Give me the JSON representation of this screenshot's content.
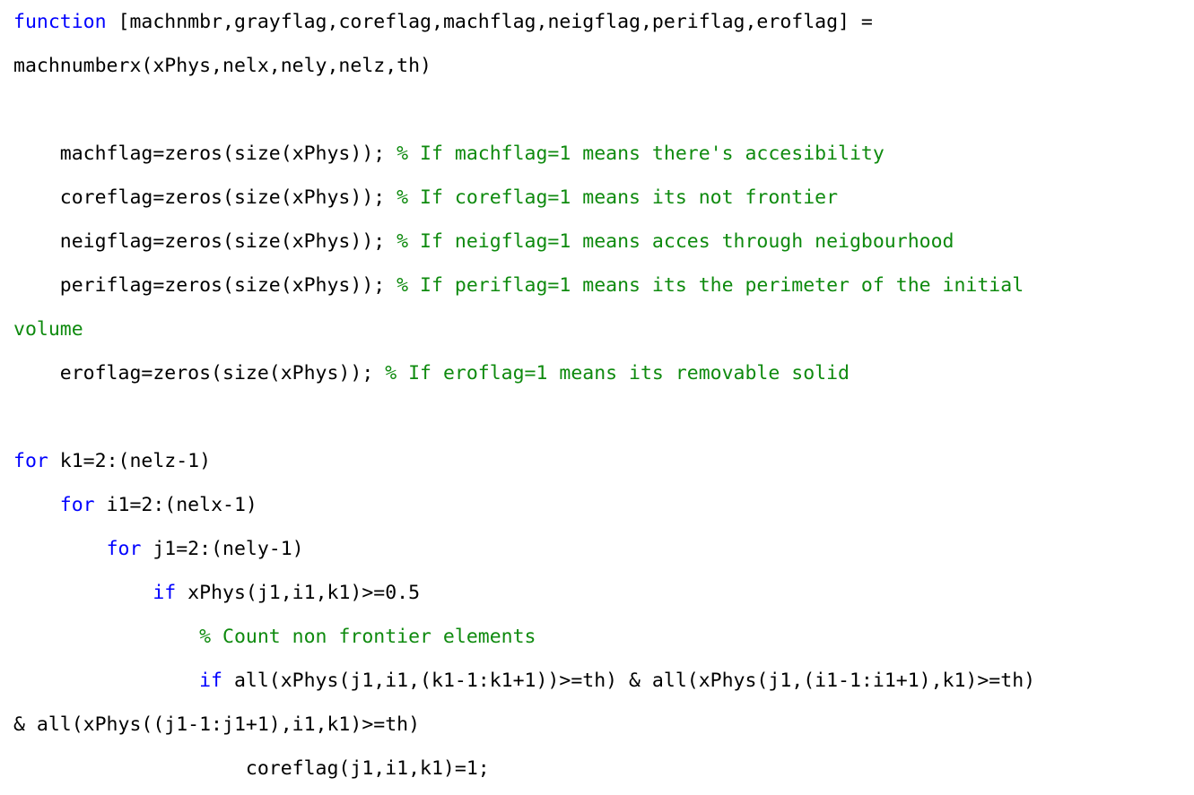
{
  "document": {
    "kind": "source-code-listing",
    "language": "MATLAB",
    "background_color": "#ffffff",
    "colors": {
      "text": "#000000",
      "keyword": "#0000ff",
      "comment": "#0e8a0e"
    }
  },
  "code": {
    "lines": [
      {
        "index": 1,
        "text": "function [machnmbr,grayflag,coreflag,machflag,neigflag,periflag,eroflag] =",
        "tokens": [
          {
            "type": "keyword",
            "text": "function"
          },
          {
            "type": "plain",
            "text": " [machnmbr,grayflag,coreflag,machflag,neigflag,periflag,eroflag] ="
          }
        ]
      },
      {
        "index": 2,
        "text": "machnumberx(xPhys,nelx,nely,nelz,th)",
        "tokens": [
          {
            "type": "plain",
            "text": "machnumberx(xPhys,nelx,nely,nelz,th)"
          }
        ]
      },
      {
        "index": 3,
        "text": "",
        "tokens": [
          {
            "type": "plain",
            "text": " "
          }
        ]
      },
      {
        "index": 4,
        "text": "    machflag=zeros(size(xPhys)); % If machflag=1 means there's accesibility",
        "tokens": [
          {
            "type": "plain",
            "text": "    machflag=zeros(size(xPhys)); "
          },
          {
            "type": "comment",
            "text": "% If machflag=1 means there's accesibility"
          }
        ]
      },
      {
        "index": 5,
        "text": "    coreflag=zeros(size(xPhys)); % If coreflag=1 means its not frontier",
        "tokens": [
          {
            "type": "plain",
            "text": "    coreflag=zeros(size(xPhys)); "
          },
          {
            "type": "comment",
            "text": "% If coreflag=1 means its not frontier"
          }
        ]
      },
      {
        "index": 6,
        "text": "    neigflag=zeros(size(xPhys)); % If neigflag=1 means acces through neigbourhood",
        "tokens": [
          {
            "type": "plain",
            "text": "    neigflag=zeros(size(xPhys)); "
          },
          {
            "type": "comment",
            "text": "% If neigflag=1 means acces through neigbourhood"
          }
        ]
      },
      {
        "index": 7,
        "text": "    periflag=zeros(size(xPhys)); % If periflag=1 means its the perimeter of the initial",
        "tokens": [
          {
            "type": "plain",
            "text": "    periflag=zeros(size(xPhys)); "
          },
          {
            "type": "comment",
            "text": "% If periflag=1 means its the perimeter of the initial"
          }
        ]
      },
      {
        "index": 8,
        "text": "volume",
        "wrapped_continuation": true,
        "tokens": [
          {
            "type": "comment",
            "text": "volume"
          }
        ]
      },
      {
        "index": 9,
        "text": "    eroflag=zeros(size(xPhys)); % If eroflag=1 means its removable solid",
        "tokens": [
          {
            "type": "plain",
            "text": "    eroflag=zeros(size(xPhys)); "
          },
          {
            "type": "comment",
            "text": "% If eroflag=1 means its removable solid"
          }
        ]
      },
      {
        "index": 10,
        "text": "",
        "tokens": [
          {
            "type": "plain",
            "text": " "
          }
        ]
      },
      {
        "index": 11,
        "text": "for k1=2:(nelz-1)",
        "tokens": [
          {
            "type": "keyword",
            "text": "for"
          },
          {
            "type": "plain",
            "text": " k1=2:(nelz-1)"
          }
        ]
      },
      {
        "index": 12,
        "text": "    for i1=2:(nelx-1)",
        "tokens": [
          {
            "type": "plain",
            "text": "    "
          },
          {
            "type": "keyword",
            "text": "for"
          },
          {
            "type": "plain",
            "text": " i1=2:(nelx-1)"
          }
        ]
      },
      {
        "index": 13,
        "text": "        for j1=2:(nely-1)",
        "tokens": [
          {
            "type": "plain",
            "text": "        "
          },
          {
            "type": "keyword",
            "text": "for"
          },
          {
            "type": "plain",
            "text": " j1=2:(nely-1)"
          }
        ]
      },
      {
        "index": 14,
        "text": "            if xPhys(j1,i1,k1)>=0.5",
        "tokens": [
          {
            "type": "plain",
            "text": "            "
          },
          {
            "type": "keyword",
            "text": "if"
          },
          {
            "type": "plain",
            "text": " xPhys(j1,i1,k1)>=0.5"
          }
        ]
      },
      {
        "index": 15,
        "text": "                % Count non frontier elements",
        "tokens": [
          {
            "type": "plain",
            "text": "                "
          },
          {
            "type": "comment",
            "text": "% Count non frontier elements"
          }
        ]
      },
      {
        "index": 16,
        "text": "                if all(xPhys(j1,i1,(k1-1:k1+1))>=th) & all(xPhys(j1,(i1-1:i1+1),k1)>=th)",
        "tokens": [
          {
            "type": "plain",
            "text": "                "
          },
          {
            "type": "keyword",
            "text": "if"
          },
          {
            "type": "plain",
            "text": " all(xPhys(j1,i1,(k1-1:k1+1))>=th) & all(xPhys(j1,(i1-1:i1+1),k1)>=th)"
          }
        ]
      },
      {
        "index": 17,
        "text": "& all(xPhys((j1-1:j1+1),i1,k1)>=th)",
        "wrapped_continuation": true,
        "tokens": [
          {
            "type": "plain",
            "text": "& all(xPhys((j1-1:j1+1),i1,k1)>=th)"
          }
        ]
      },
      {
        "index": 18,
        "text": "                    coreflag(j1,i1,k1)=1;",
        "tokens": [
          {
            "type": "plain",
            "text": "                    coreflag(j1,i1,k1)=1;"
          }
        ]
      }
    ]
  }
}
